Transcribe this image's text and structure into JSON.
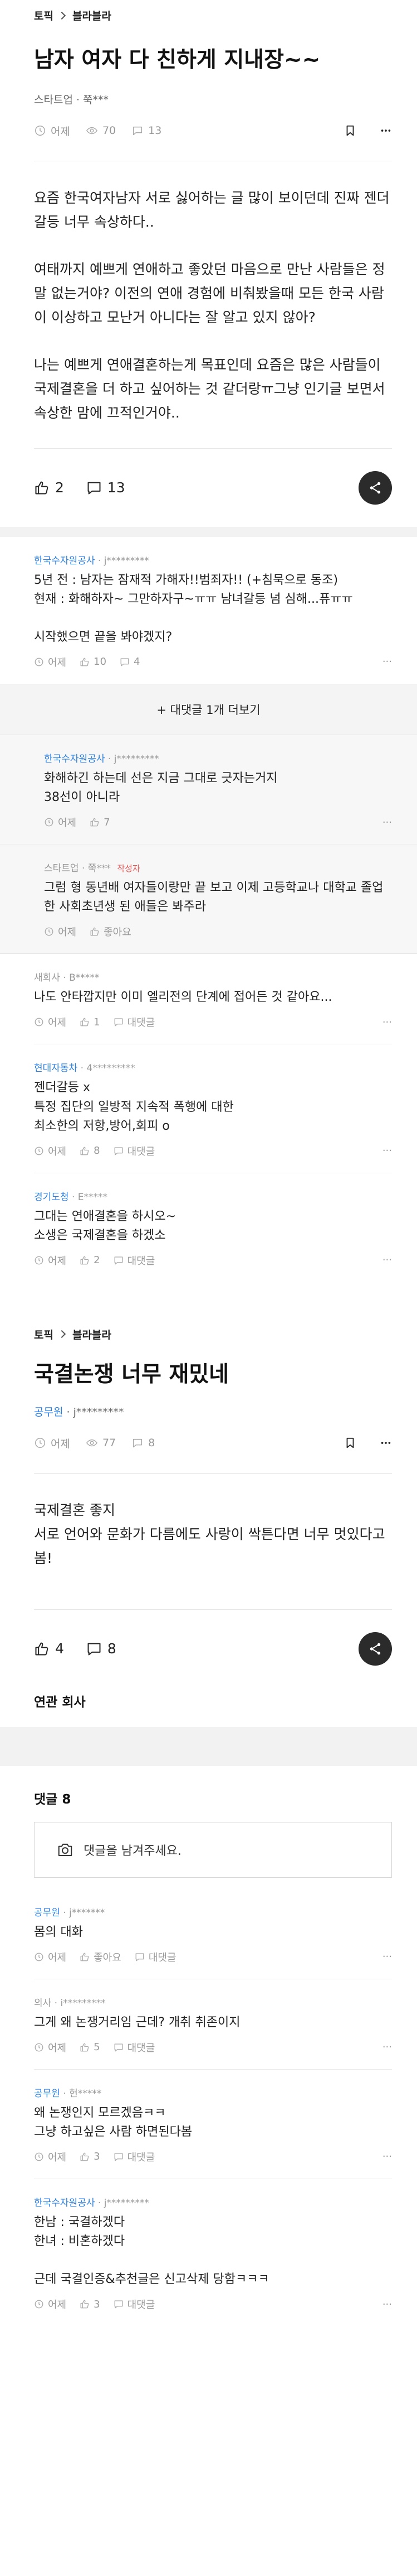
{
  "post1": {
    "breadcrumb": [
      "토픽",
      "블라블라"
    ],
    "title": "남자 여자 다 친하게 지내장~~",
    "author": "스타트업 · 쭉***",
    "time": "어제",
    "views": "70",
    "comments": "13",
    "paragraphs": [
      "요즘 한국여자남자 서로 싫어하는 글 많이 보이던데 진짜 젠더갈등 너무 속상하다..",
      "여태까지 예쁘게 연애하고 좋았던 마음으로 만난 사람들은 정말 없는거야? 이전의 연애 경험에 비춰봤을때 모든 한국 사람이 이상하고 모난거 아니다는 잘 알고 있지 않아?",
      "나는 예쁘게 연애결혼하는게 목표인데 요즘은 많은 사람들이 국제결혼을 더 하고 싶어하는 것 같더랑ㅠ그냥 인기글 보면서 속상한 맘에 끄적인거야.."
    ],
    "likes": "2",
    "comment_count": "13"
  },
  "comments1": [
    {
      "company": "한국수자원공사",
      "user": " · j*********",
      "lines": [
        "5년 전 : 남자는 잠재적 가해자!!범죄자!! (+침묵으로 동조)",
        "현재 : 화해하자~ 그만하자구~ㅠㅠ 남녀갈등 넘 심해...퓨ㅠㅠ",
        "",
        "시작했으면 끝을 봐야겠지?"
      ],
      "time": "어제",
      "likes": "10",
      "replies": "4"
    }
  ],
  "more_replies": "+ 대댓글 1개 더보기",
  "replies1": [
    {
      "company": "한국수자원공사",
      "user": " · j*********",
      "lines": [
        "화해하긴 하는데 선은 지금 그대로 긋자는거지",
        "38선이 아니라"
      ],
      "time": "어제",
      "likes": "7"
    },
    {
      "company": "스타트업",
      "user": " · 쭉*** ",
      "writer": "작성자",
      "lines": [
        "그럼 형 동년배 여자들이랑만 끝 보고 이제 고등학교나 대학교 졸업한 사회초년생 된 애들은 봐주라"
      ],
      "time": "어제",
      "likes": "좋아요"
    }
  ],
  "comments2": [
    {
      "company": "새회사",
      "user": " · B*****",
      "grey": true,
      "lines": [
        "나도 안타깝지만 이미 엘리전의 단계에 접어든 것 같아요..."
      ],
      "time": "어제",
      "likes": "1",
      "replies": "대댓글"
    },
    {
      "company": "현대자동차",
      "user": " · 4*********",
      "lines": [
        "젠더갈등 x",
        "특정 집단의 일방적 지속적 폭행에 대한",
        "최소한의 저항,방어,회피 o"
      ],
      "time": "어제",
      "likes": "8",
      "replies": "대댓글"
    },
    {
      "company": "경기도청",
      "user": " · E*****",
      "lines": [
        "그대는 연애결혼을 하시오~",
        "소생은 국제결혼을 하겠소"
      ],
      "time": "어제",
      "likes": "2",
      "replies": "대댓글"
    }
  ],
  "post2": {
    "breadcrumb": [
      "토픽",
      "블라블라"
    ],
    "title": "국결논쟁 너무 재밌네",
    "company": "공무원",
    "user": " · j*********",
    "time": "어제",
    "views": "77",
    "comments": "8",
    "paragraphs": [
      "국제결혼 좋지",
      "서로 언어와 문화가 다름에도 사랑이 싹튼다면 너무 멋있다고 봄!"
    ],
    "likes": "4",
    "comment_count": "8"
  },
  "related_label": "연관 회사",
  "comment_section_label": "댓글 8",
  "comment_placeholder": "댓글을 남겨주세요.",
  "comments3": [
    {
      "company": "공무원",
      "user": " · j*******",
      "lines": [
        "몸의 대화"
      ],
      "time": "어제",
      "likes": "좋아요",
      "replies": "대댓글"
    },
    {
      "company": "의사",
      "user": " · i*********",
      "grey": true,
      "lines": [
        "그게 왜 논쟁거리임 근데? 개취 취존이지"
      ],
      "time": "어제",
      "likes": "5",
      "replies": "대댓글"
    },
    {
      "company": "공무원",
      "user": " · 현*****",
      "lines": [
        "왜 논쟁인지 모르겠음ㅋㅋ",
        "그냥 하고싶은 사람 하면된다봄"
      ],
      "time": "어제",
      "likes": "3",
      "replies": "대댓글"
    },
    {
      "company": "한국수자원공사",
      "user": " · j*********",
      "lines": [
        "한남 : 국결하겠다",
        "한녀 : 비혼하겠다",
        "",
        "근데 국결인증&추천글은 신고삭제 당함ㅋㅋㅋ"
      ],
      "time": "어제",
      "likes": "3",
      "replies": "대댓글"
    }
  ]
}
